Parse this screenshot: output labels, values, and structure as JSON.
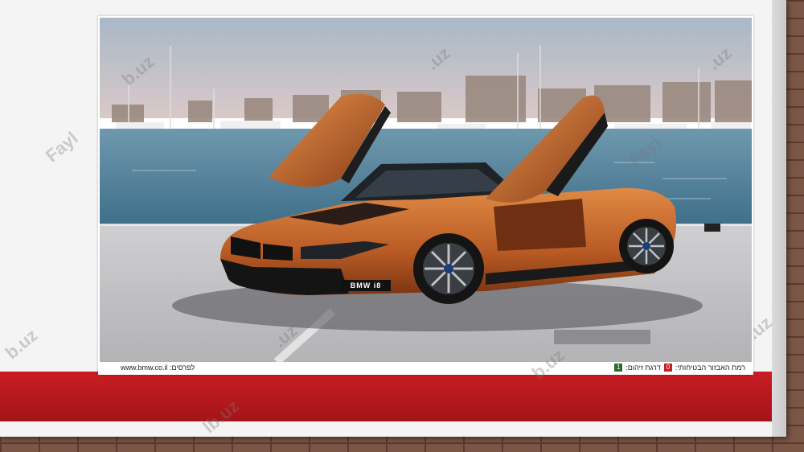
{
  "photo": {
    "plate_text": "BMW i8",
    "caption_left": "לפרסים: www.bmw.co.il",
    "caption_right_1": "רמת האבזור הבטיחותי:",
    "caption_right_1_value": "0",
    "caption_right_2": "דרגת זיהום:",
    "caption_right_2_value": "1"
  },
  "watermarks": [
    "Fayl",
    "b.uz",
    ".uz",
    ".uz",
    "Fayl",
    "b.uz",
    ".uz",
    "b.uz",
    ".uz",
    "lb.uz"
  ],
  "colors": {
    "red_band": "#c81d22",
    "car_orange": "#c8692e",
    "sea": "#5c8ea6",
    "sky": "#b8c4d0"
  }
}
